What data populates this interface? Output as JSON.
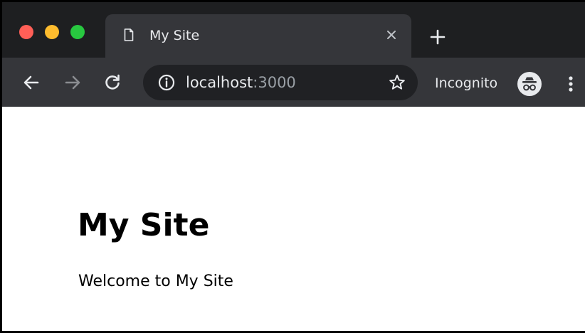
{
  "browser": {
    "window_controls": [
      "close",
      "minimize",
      "zoom"
    ],
    "tab": {
      "title": "My Site",
      "favicon_icon": "document-icon",
      "close_icon": "close-icon"
    },
    "new_tab_icon": "plus-icon",
    "toolbar": {
      "back_icon": "arrow-left-icon",
      "forward_icon": "arrow-right-icon",
      "reload_icon": "reload-icon",
      "site_info_icon": "info-icon",
      "url_host": "localhost",
      "url_port": ":3000",
      "bookmark_icon": "star-icon",
      "incognito_label": "Incognito",
      "incognito_icon": "incognito-icon",
      "menu_icon": "more-vert-icon"
    },
    "colors": {
      "tabstrip_bg": "#1e1f21",
      "toolbar_bg": "#35363a",
      "omnibox_bg": "#202124",
      "traffic_red": "#ff5f57",
      "traffic_yellow": "#febc2e",
      "traffic_green": "#28c840"
    }
  },
  "page": {
    "heading": "My Site",
    "text": "Welcome to My Site"
  }
}
